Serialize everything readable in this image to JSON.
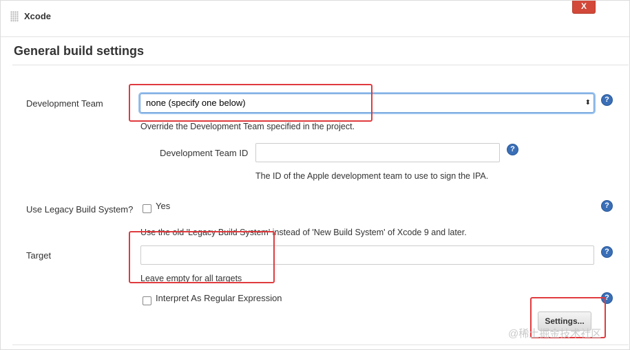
{
  "header": {
    "title": "Xcode",
    "close_label": "X"
  },
  "section": {
    "title": "General build settings"
  },
  "dev_team": {
    "label": "Development Team",
    "selected": "none (specify one below)",
    "description": "Override the Development Team specified in the project."
  },
  "dev_team_id": {
    "label": "Development Team ID",
    "value": "",
    "description": "The ID of the Apple development team to use to sign the IPA."
  },
  "legacy_build": {
    "label": "Use Legacy Build System?",
    "checkbox_label": "Yes",
    "checked": false,
    "description": "Use the old 'Legacy Build System' instead of 'New Build System' of Xcode 9 and later."
  },
  "target": {
    "label": "Target",
    "value": "",
    "description": "Leave empty for all targets",
    "regex_label": "Interpret As Regular Expression",
    "regex_checked": false
  },
  "settings_button": {
    "label": "Settings..."
  },
  "help_icon_glyph": "?",
  "watermark": "@稀土掘金技术社区",
  "colors": {
    "highlight": "#e03a3e",
    "help": "#3a6fb7",
    "close": "#d24939"
  }
}
